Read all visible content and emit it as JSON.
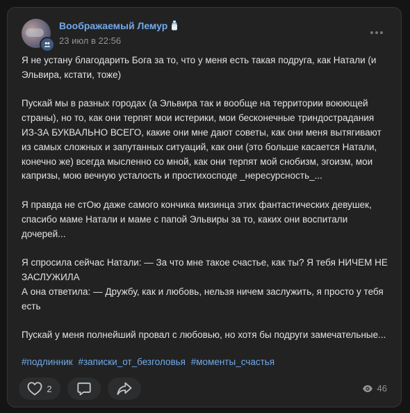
{
  "post": {
    "author": "Воображаемый Лемур",
    "date": "23 июл в 22:56",
    "paragraphs": [
      "Я не устану благодарить Бога за то, что у меня есть такая подруга, как Натали (и Эльвира, кстати, тоже)",
      "Пускай мы в разных городах (а Эльвира так и вообще на территории воюющей страны), но то, как они терпят мои истерики, мои бесконечные триндострадания ИЗ-ЗА БУКВАЛЬНО ВСЕГО, какие они мне дают советы, как они меня вытягивают из самых сложных и запутанных ситуаций, как они (это больше касается Натали, конечно же) всегда мысленно со мной, как они терпят мой снобизм, эгоизм, мои капризы, мою вечную усталость и простихосподе _нересурсность_...",
      "Я правда не стОю даже самого кончика мизинца этих фантастических девушек, спасибо маме Натали и маме с папой Эльвиры за то, каких они воспитали дочерей...",
      "Я спросила сейчас Натали: — За что мне такое счастье, как ты? Я тебя НИЧЕМ НЕ ЗАСЛУЖИЛА\nА она ответила: — Дружбу, как и любовь, нельзя ничем заслужить, я просто у тебя есть",
      "Пускай у меня полнейший провал с любовью, но хотя бы подруги замечательные..."
    ],
    "hashtags": [
      "#подлинник",
      "#записки_от_безголовья",
      "#моменты_счастья"
    ]
  },
  "actions": {
    "likes": "2",
    "views": "46"
  },
  "icons": {
    "avatar_badge": "group-icon",
    "author_emoji": "baby-bottle-icon",
    "more": "more-dots-icon",
    "like": "heart-icon",
    "comment": "comment-icon",
    "share": "share-arrow-icon",
    "views": "eye-icon"
  },
  "colors": {
    "background": "#141414",
    "card": "#222222",
    "text": "#e1e3e6",
    "link": "#71aaeb",
    "muted": "#939393",
    "button": "#2c2d2e"
  }
}
